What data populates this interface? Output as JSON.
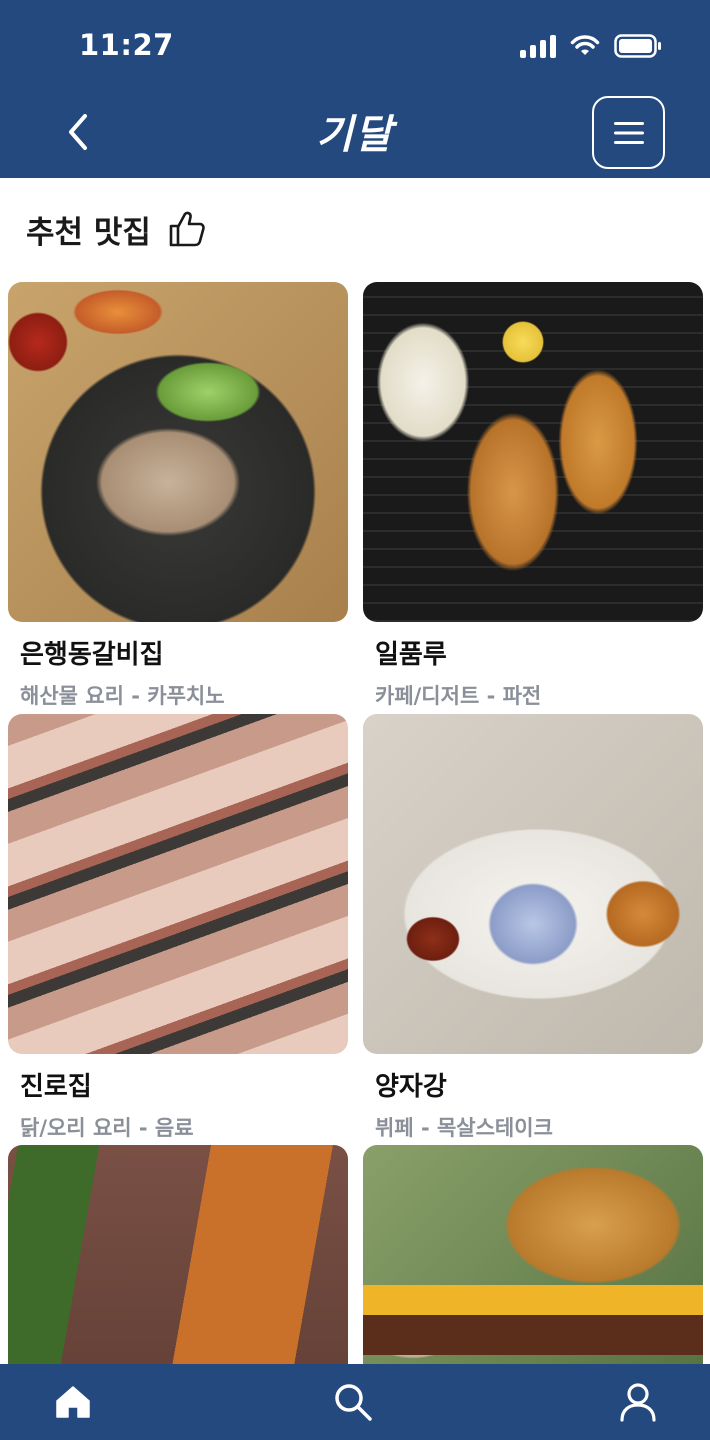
{
  "status_bar": {
    "time": "11:27"
  },
  "header": {
    "title": "기달"
  },
  "section": {
    "title": "추천 맛집"
  },
  "restaurants": [
    {
      "name": "은행동갈비집",
      "meta": "해산물 요리 - 카푸치노"
    },
    {
      "name": "일품루",
      "meta": "카페/디저트 - 파전"
    },
    {
      "name": "진로집",
      "meta": "닭/오리 요리 - 음료"
    },
    {
      "name": "양자강",
      "meta": "뷔페 - 목살스테이크"
    },
    {
      "name": "",
      "meta": ""
    },
    {
      "name": "",
      "meta": ""
    }
  ],
  "colors": {
    "brand": "#24497f",
    "meta_text": "#8a8f99"
  },
  "icons": {
    "back": "chevron-left-icon",
    "menu": "hamburger-icon",
    "thumbs_up": "thumbs-up-icon",
    "home": "home-icon",
    "search": "search-icon",
    "profile": "person-icon"
  }
}
